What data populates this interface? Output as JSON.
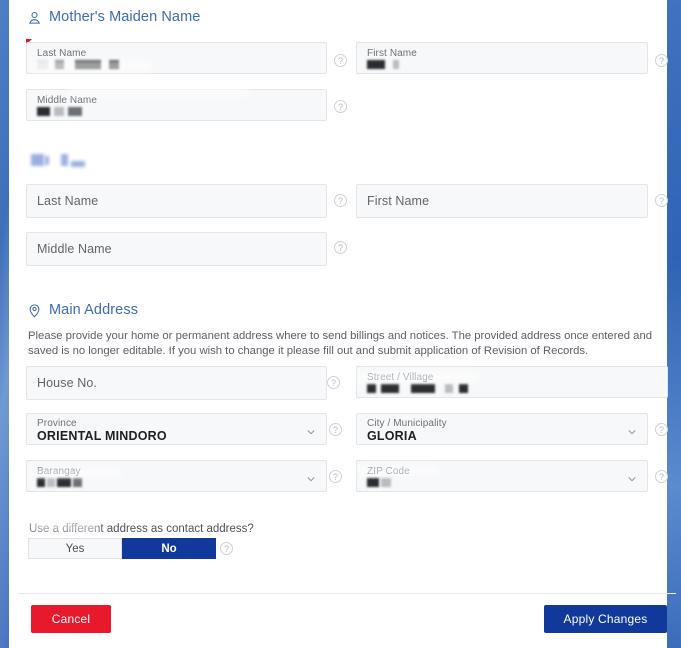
{
  "sections": {
    "maiden_name": {
      "icon": "person-icon",
      "title": "Mother's Maiden Name"
    },
    "main_address": {
      "icon": "location-pin-icon",
      "title": "Main Address",
      "description": "Please provide your home or permanent address where to send billings and notices. The provided address once entered and saved is no longer editable. If you wish to change it please fill out and submit application of Revision of Records."
    }
  },
  "maiden_fields": {
    "last_name_label": "Last Name",
    "last_name_value": "",
    "first_name_label": "First Name",
    "first_name_value": "",
    "middle_name_label": "Middle Name",
    "middle_name_value": ""
  },
  "spouse_fields": {
    "heading": "",
    "last_name_placeholder": "Last Name",
    "first_name_placeholder": "First Name",
    "middle_name_placeholder": "Middle Name"
  },
  "address_fields": {
    "house_no_placeholder": "House No.",
    "street_label": "Street / Village",
    "street_value": "",
    "province_label": "Province",
    "province_value": "ORIENTAL MINDORO",
    "city_label": "City / Municipality",
    "city_value": "GLORIA",
    "barangay_label": "Barangay",
    "barangay_value": "",
    "zip_label": "ZIP Code",
    "zip_value": ""
  },
  "contact_address_toggle": {
    "question": "Use a different address as contact address?",
    "yes_label": "Yes",
    "no_label": "No",
    "selected": "No"
  },
  "footer": {
    "cancel_label": "Cancel",
    "apply_label": "Apply Changes"
  },
  "icons": {
    "help": "?",
    "chevron_down": "chevron-down-icon"
  },
  "colors": {
    "accent_blue": "#3b6cb5",
    "primary_blue": "#10399b",
    "danger_red": "#e8192c",
    "field_bg": "#f7f8f9",
    "field_border": "#e3e5e8"
  }
}
